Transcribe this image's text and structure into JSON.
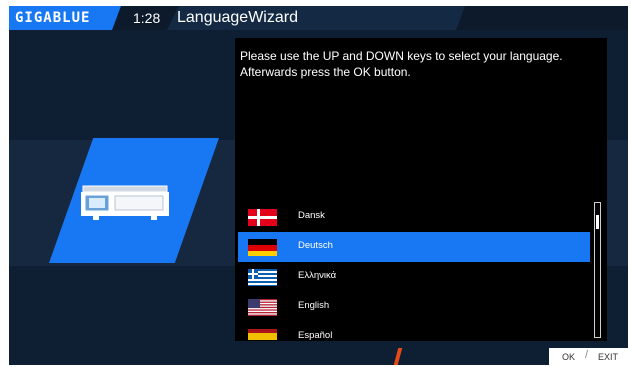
{
  "header": {
    "logo_text": "GIGABLUE",
    "time": "1:28",
    "title": "LanguageWizard"
  },
  "dialog": {
    "instruction": "Please use the UP and DOWN keys to select your language. Afterwards press the OK button."
  },
  "languages": [
    {
      "label": "Dansk",
      "flag": "denmark-flag",
      "selected": false
    },
    {
      "label": "Deutsch",
      "flag": "germany-flag",
      "selected": true
    },
    {
      "label": "Ελληνικά",
      "flag": "greece-flag",
      "selected": false
    },
    {
      "label": "English",
      "flag": "usa-flag",
      "selected": false
    },
    {
      "label": "Español",
      "flag": "spain-flag",
      "selected": false
    }
  ],
  "footer": {
    "ok_label": "OK",
    "separator": "/",
    "exit_label": "EXIT"
  },
  "colors": {
    "accent": "#1877f2",
    "background": "#0f1f33",
    "dialog_bg": "#000000"
  }
}
